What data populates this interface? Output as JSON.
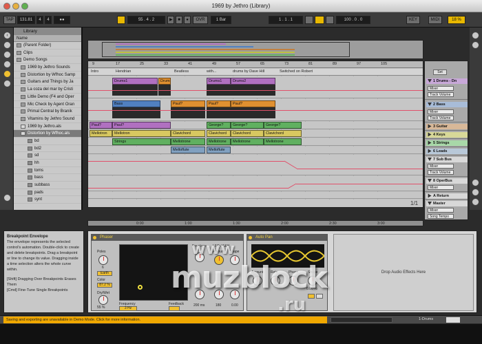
{
  "window": {
    "title": "1969 by Jethro (Library)"
  },
  "controlbar": {
    "tap": "TAP",
    "tempo": "131.81",
    "meter_num": "4",
    "meter_den": "4",
    "ooo": "●●",
    "loop_pos": "55 . 4 . 2",
    "ovr": "OVR",
    "quant": "1 Bar",
    "punch_pos": "1 . 1 . 1",
    "loop_len": "100 . 0 . 0",
    "key": "KEY",
    "midi": "MIDI",
    "cpu": "18 %",
    "colors": {
      "accent": "#e8b800"
    }
  },
  "browser": {
    "header": "Library",
    "column": "Name",
    "items": [
      "(Parent Folder)",
      "Clips",
      "Demo Songs",
      "1969 by Jethro Sounds",
      "Distortion by Wfhoc Samp",
      "Guitars and Things by Ja",
      "La coza del mar by Cristi",
      "Little Demo (F4 and Oper",
      "Mic Check by Agent Oran",
      "Primal Central by Branik",
      "Vitamins by Jethro Sound",
      "1969 by Jethro.als",
      "Distortion by Wfhoc.als",
      "bd",
      "bd2",
      "sd",
      "hh",
      "toms",
      "bass",
      "subbass",
      "pads",
      "synt"
    ]
  },
  "ruler": {
    "ticks": [
      "9",
      "17",
      "25",
      "33",
      "41",
      "49",
      "57",
      "65",
      "73",
      "81",
      "89",
      "97",
      "105"
    ]
  },
  "locators": [
    "Intro",
    "Hendrian",
    "Beatless",
    "with...",
    "drums by Dave Hill",
    "Switched on Robert"
  ],
  "clips": {
    "drum1": "Drums1",
    "drum2": "Drums2",
    "drum3": "Drums1",
    "drum4": "Drums2",
    "bass1": "Bass",
    "bass2": "Paul?",
    "bass3": "Paul?",
    "bass4": "Paul?",
    "guitar1": "Paul?",
    "guitar2": "Paul?",
    "guitar3": "George?",
    "guitar4": "George?",
    "guitar5": "George?",
    "keys1": "Mellotron",
    "keys2": "Mellotron",
    "keys3": "Clavichord",
    "keys4": "Clavichord",
    "keys5": "Clavichord",
    "keys6": "Clavichord",
    "str1": "Strings",
    "str2": "Mellotrone",
    "str3": "Mellotrone",
    "str4": "Mellotrone",
    "str5": "Mellotrone",
    "lead1": "Melloflute",
    "lead2": "Melloflute"
  },
  "timeline": [
    "0:00",
    "1:00",
    "1:30",
    "2:00",
    "2:30",
    "3:00"
  ],
  "zoom_label": "1/1",
  "mixer": {
    "tracks": [
      {
        "name": "1 Drums - Dn",
        "color": "#b070c0",
        "sel1": "Mixer",
        "sel2": "Track Volume"
      },
      {
        "name": "2 Bass",
        "color": "#5080c0",
        "sel1": "Mixer",
        "sel2": "Track Volume"
      },
      {
        "name": "3 Guitar",
        "color": "#c08040"
      },
      {
        "name": "4 Keys",
        "color": "#c0c040"
      },
      {
        "name": "5 Strings",
        "color": "#60b060"
      },
      {
        "name": "6 Leads",
        "color": "#80a0c0"
      },
      {
        "name": "7 Sub Bus",
        "color": "#aaa",
        "sel1": "Mixer",
        "sel2": "Track Volume"
      },
      {
        "name": "8 OperBus",
        "color": "#aaa",
        "sel1": "Mixer"
      },
      {
        "name": "A Return",
        "color": "#aaa"
      },
      {
        "name": "Master",
        "color": "#aaa",
        "sel1": "Mixer",
        "sel2": "Song Tempo"
      }
    ],
    "set_label": "Set"
  },
  "info": {
    "title": "Breakpoint Envelope",
    "body": "The envelope represents the selected control's automation. Double-click to create and delete breakpoints. Drag a breakpoint or line to change its value. Dragging inside a time selection alters the whole curve within.",
    "hint1": "[Shift] Dragging Over Breakpoints Erases Them",
    "hint2": "[Cmd] Fine-Tune Single Breakpoints"
  },
  "phaser": {
    "title": "Phaser",
    "poles_label": "Poles",
    "poles": "6",
    "earth": "Earth",
    "color_label": "Color",
    "color": "87.2 %",
    "dry_wet_label": "Dry/Wet",
    "dry_wet": "55 %",
    "frequency_label": "Frequency",
    "frequency": "3 Hz",
    "feedback_label": "Feedback",
    "envelope_label": "Envelope",
    "lfo_label": "LFO / S&H",
    "amount_label": "Amount",
    "shape_label": "Shape",
    "env_val": "200 ms",
    "lfo_val": "180",
    "shape_val": "0.00"
  },
  "autopan": {
    "title": "Auto Pan",
    "amount_label": "Amount",
    "rate_label": "Rate",
    "phase_label": "Phase",
    "shape_label": "Shape",
    "shape_val": "0.00 %"
  },
  "drop_zone": "Drop Audio Effects Here",
  "status": {
    "message": "Saving and exporting are unavailable in Demo Mode. Click for more information.",
    "track": "1-Drums"
  },
  "watermark": {
    "www": "www",
    "name": "muzblock",
    "ru": ".ru"
  }
}
